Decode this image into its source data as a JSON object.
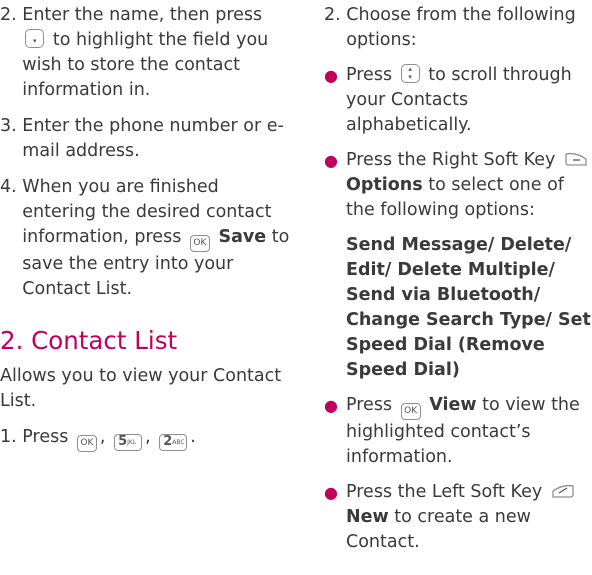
{
  "left": {
    "step2": {
      "num": "2. ",
      "text_a": "Enter the name, then press",
      "text_b": "to highlight the field you wish to store the contact information in."
    },
    "step3": {
      "num": "3. ",
      "text": "Enter the phone number or e-mail address."
    },
    "step4": {
      "num": "4. ",
      "text_a": "When you are finished entering the desired contact information, press",
      "save": "Save",
      "text_b": "to save the entry into your Contact List."
    },
    "heading": "2. Contact List",
    "intro": "Allows you to view your Contact List.",
    "step1": {
      "num": "1. ",
      "text": "Press",
      "sep1": ",",
      "sep2": ",",
      "end": "."
    }
  },
  "right": {
    "step2": {
      "num": "2. ",
      "text": "Choose from the following options:"
    },
    "b1": {
      "a": "Press",
      "b": "to scroll through your Contacts alphabetically."
    },
    "b2": {
      "a": "Press the Right Soft Key",
      "options": "Options",
      "b": "to select one of the following options:"
    },
    "option_list": "Send Message/ Delete/ Edit/ Delete Multiple/ Send via Bluetooth/ Change Search Type/ Set Speed Dial (Remove Speed Dial)",
    "b3": {
      "a": "Press",
      "view": "View",
      "b": "to view the highlighted contact’s information."
    },
    "b4": {
      "a": "Press the Left Soft Key",
      "new": "New",
      "b": "to create a new Contact."
    }
  },
  "keys": {
    "ok": "OK",
    "five": "5",
    "five_sub": "JKL",
    "two": "2",
    "two_sub": "ABC"
  },
  "colors": {
    "accent": "#c0005c",
    "text": "#3a3a3a"
  }
}
